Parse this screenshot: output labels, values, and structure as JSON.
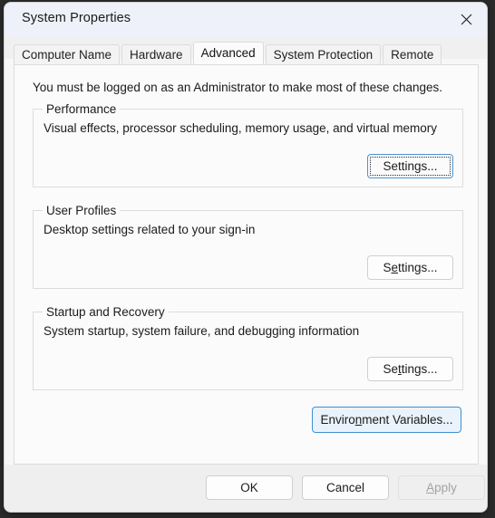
{
  "window": {
    "title": "System Properties",
    "close_icon": "close-icon"
  },
  "tabs": [
    {
      "label": "Computer Name",
      "selected": false
    },
    {
      "label": "Hardware",
      "selected": false
    },
    {
      "label": "Advanced",
      "selected": true
    },
    {
      "label": "System Protection",
      "selected": false
    },
    {
      "label": "Remote",
      "selected": false
    }
  ],
  "page": {
    "intro": "You must be logged on as an Administrator to make most of these changes.",
    "groups": [
      {
        "label": "Performance",
        "description": "Visual effects, processor scheduling, memory usage, and virtual memory",
        "button": {
          "pre": "S",
          "acc": "",
          "post": "ettings...",
          "label": "Settings...",
          "state": "focused"
        }
      },
      {
        "label": "User Profiles",
        "description": "Desktop settings related to your sign-in",
        "button": {
          "pre": "S",
          "acc": "e",
          "post": "ttings...",
          "label": "Settings...",
          "state": "normal"
        }
      },
      {
        "label": "Startup and Recovery",
        "description": "System startup, system failure, and debugging information",
        "button": {
          "pre": "Se",
          "acc": "t",
          "post": "tings...",
          "label": "Settings...",
          "state": "normal"
        }
      }
    ],
    "env_button": {
      "pre": "Enviro",
      "acc": "n",
      "post": "ment Variables...",
      "label": "Environment Variables...",
      "state": "accent"
    }
  },
  "commandbar": {
    "ok": {
      "pre": "OK",
      "acc": "",
      "post": "",
      "label": "OK"
    },
    "cancel": {
      "pre": "Cancel",
      "acc": "",
      "post": "",
      "label": "Cancel"
    },
    "apply": {
      "pre": "",
      "acc": "A",
      "post": "pply",
      "label": "Apply",
      "disabled": true
    }
  },
  "colors": {
    "titlebar": "#eef1f9",
    "tabstrip": "#f0f0f0",
    "page": "#fbfbfb",
    "commandbar": "#efefef",
    "accent_border": "#3f8fd0",
    "accent_fill": "#eaf3fb",
    "focus_border": "#4b93d1",
    "disabled_text": "#a3a3a3"
  }
}
